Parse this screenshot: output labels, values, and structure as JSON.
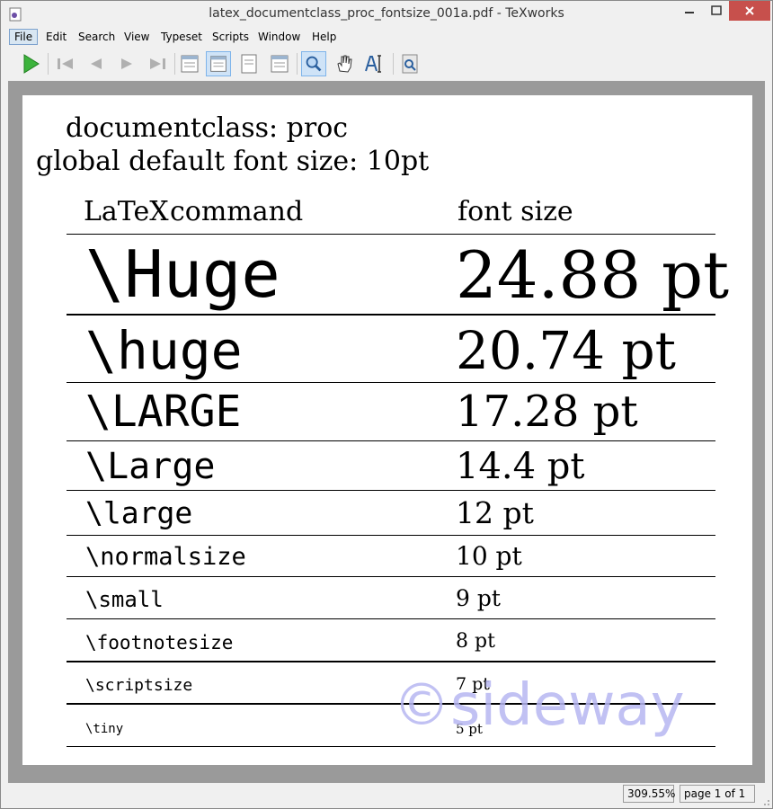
{
  "window": {
    "title": "latex_documentclass_proc_fontsize_001a.pdf - TeXworks"
  },
  "menu": {
    "items": [
      "File",
      "Edit",
      "Search",
      "View",
      "Typeset",
      "Scripts",
      "Window",
      "Help"
    ]
  },
  "document": {
    "line1": "documentclass: proc",
    "line2": "global default font size: 10pt",
    "header_cmd_latex_logo": "LaTeX",
    "header_cmd": "command",
    "header_size": "font size",
    "rows": [
      {
        "command": "\\Huge",
        "size": "24.88 pt"
      },
      {
        "command": "\\huge",
        "size": "20.74 pt"
      },
      {
        "command": "\\LARGE",
        "size": "17.28 pt"
      },
      {
        "command": "\\Large",
        "size": "14.4 pt"
      },
      {
        "command": "\\large",
        "size": "12 pt"
      },
      {
        "command": "\\normalsize",
        "size": "10 pt"
      },
      {
        "command": "\\small",
        "size": "9 pt"
      },
      {
        "command": "\\footnotesize",
        "size": "8 pt"
      },
      {
        "command": "\\scriptsize",
        "size": "7 pt"
      },
      {
        "command": "\\tiny",
        "size": "5 pt"
      }
    ],
    "watermark": "©sideway"
  },
  "status": {
    "zoom": "309.55%",
    "page": "page 1 of 1"
  }
}
